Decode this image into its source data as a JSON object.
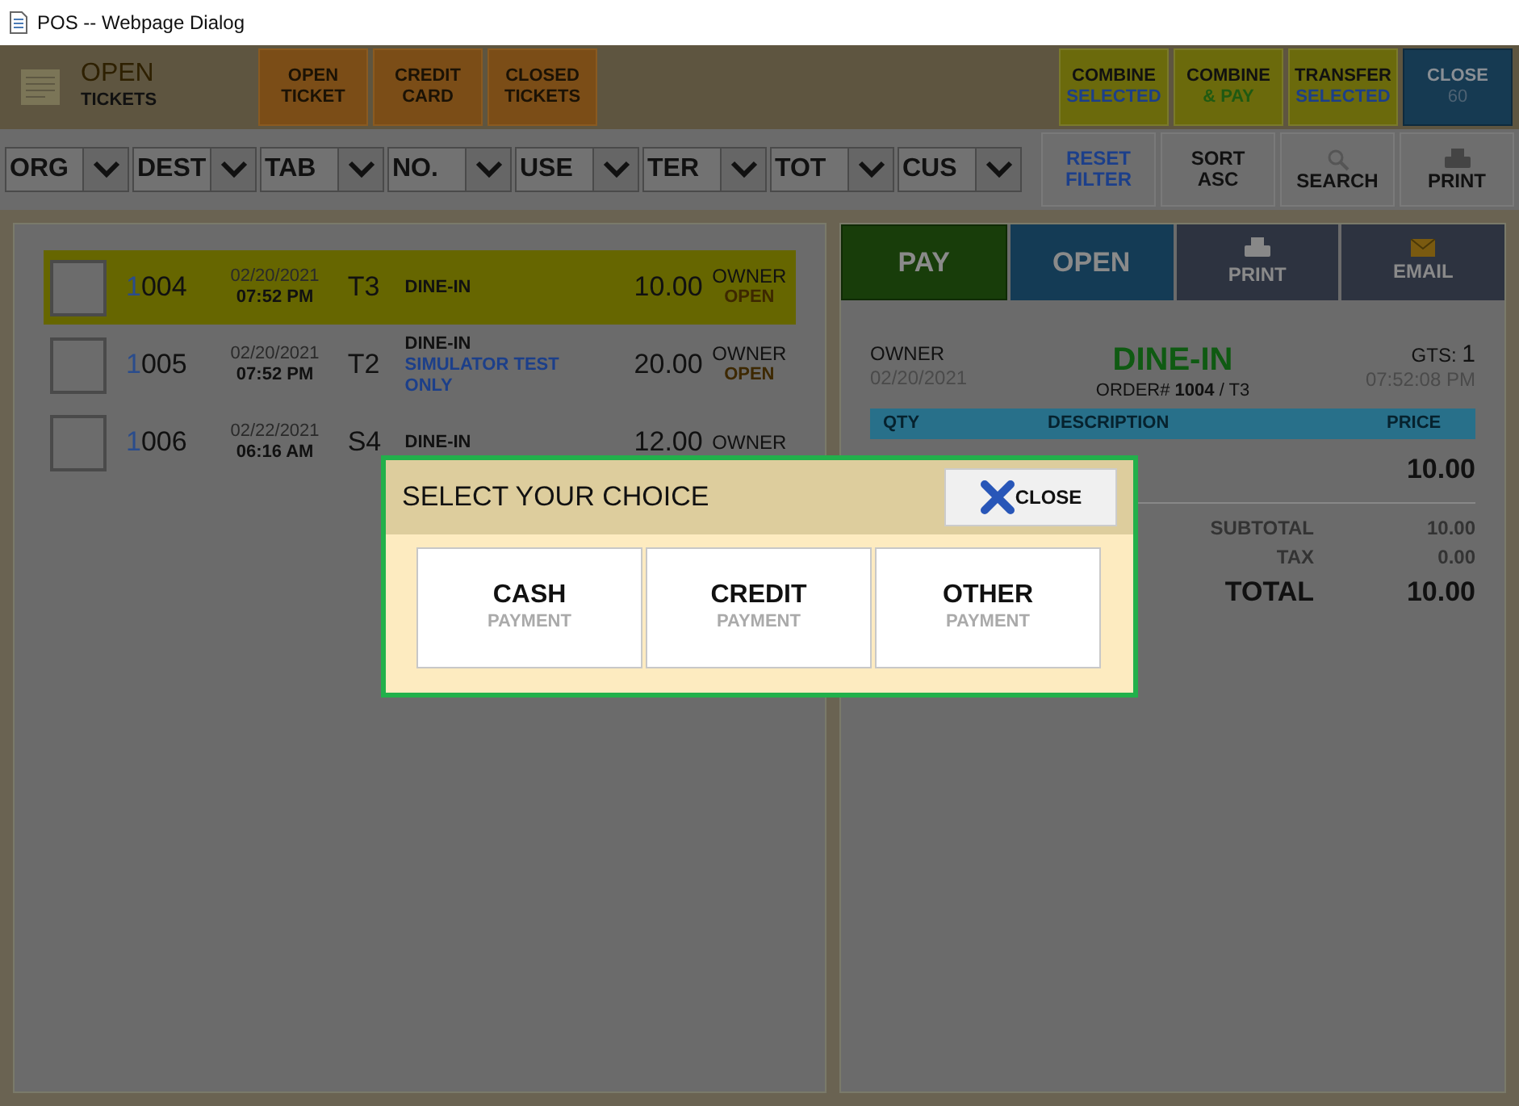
{
  "window": {
    "title": "POS -- Webpage Dialog"
  },
  "header": {
    "title_top": "OPEN",
    "title_bottom": "TICKETS",
    "left_buttons": [
      {
        "kind": "orange",
        "line1": "OPEN",
        "line2": "TICKET"
      },
      {
        "kind": "orange",
        "line1": "CREDIT",
        "line2": "CARD"
      },
      {
        "kind": "orange",
        "line1": "CLOSED",
        "line2": "TICKETS"
      }
    ],
    "right_buttons": [
      {
        "kind": "yellow",
        "color": "#1c3f8a",
        "line1": "COMBINE",
        "line2": "SELECTED"
      },
      {
        "kind": "yellow",
        "color": "#1f5a12",
        "line1": "COMBINE",
        "line2": "& PAY"
      },
      {
        "kind": "yellow",
        "color": "#1c3f8a",
        "line1": "TRANSFER",
        "line2": "SELECTED"
      },
      {
        "kind": "dark",
        "line1": "CLOSE",
        "line2": "60"
      }
    ]
  },
  "filters": [
    {
      "label": "ORG"
    },
    {
      "label": "DEST"
    },
    {
      "label": "TAB"
    },
    {
      "label": "NO."
    },
    {
      "label": "USE"
    },
    {
      "label": "TER"
    },
    {
      "label": "TOT"
    },
    {
      "label": "CUS"
    }
  ],
  "tools": [
    {
      "kind": "reset",
      "line1": "RESET",
      "line2": "FILTER"
    },
    {
      "kind": "text",
      "line1": "SORT",
      "line2": "ASC"
    },
    {
      "kind": "search",
      "line1": "SEARCH"
    },
    {
      "kind": "print",
      "line1": "PRINT"
    }
  ],
  "tickets": [
    {
      "selected": true,
      "checked": false,
      "number_prefix": "1",
      "number": "004",
      "date": "02/20/2021",
      "time": "07:52 PM",
      "table": "T3",
      "lines": [
        "DINE-IN"
      ],
      "amount": "10.00",
      "user": "OWNER",
      "status": "OPEN"
    },
    {
      "selected": false,
      "checked": false,
      "number_prefix": "1",
      "number": "005",
      "date": "02/20/2021",
      "time": "07:52 PM",
      "table": "T2",
      "lines": [
        "DINE-IN"
      ],
      "note": "SIMULATOR TEST ONLY",
      "amount": "20.00",
      "user": "OWNER",
      "status": "OPEN"
    },
    {
      "selected": false,
      "checked": false,
      "number_prefix": "1",
      "number": "006",
      "date": "02/22/2021",
      "time": "06:16 AM",
      "table": "S4",
      "lines": [
        "DINE-IN"
      ],
      "amount": "12.00",
      "user": "OWNER"
    }
  ],
  "detail_tabs": [
    {
      "kind": "pay",
      "label": "PAY"
    },
    {
      "kind": "open",
      "label": "OPEN"
    },
    {
      "kind": "print",
      "label": "PRINT"
    },
    {
      "kind": "email",
      "label": "EMAIL"
    }
  ],
  "receipt": {
    "user": "OWNER",
    "date": "02/20/2021",
    "title": "DINE-IN",
    "order": "ORDER# **1004** / T3",
    "gts_label": "GTS:",
    "gts_value": "1",
    "time": "07:52:08 PM",
    "columns": [
      "QTY",
      "DESCRIPTION",
      "PRICE"
    ],
    "item_price": "10.00",
    "totals": [
      {
        "kind": "normal",
        "label": "SUBTOTAL",
        "value": "10.00"
      },
      {
        "kind": "normal",
        "label": "TAX",
        "value": "0.00"
      },
      {
        "kind": "total",
        "label": "TOTAL",
        "value": "10.00"
      }
    ]
  },
  "modal": {
    "title": "SELECT YOUR CHOICE",
    "close_label": "CLOSE",
    "options": [
      {
        "title": "CASH",
        "subtitle": "PAYMENT"
      },
      {
        "title": "CREDIT",
        "subtitle": "PAYMENT"
      },
      {
        "title": "OTHER",
        "subtitle": "PAYMENT"
      }
    ]
  }
}
